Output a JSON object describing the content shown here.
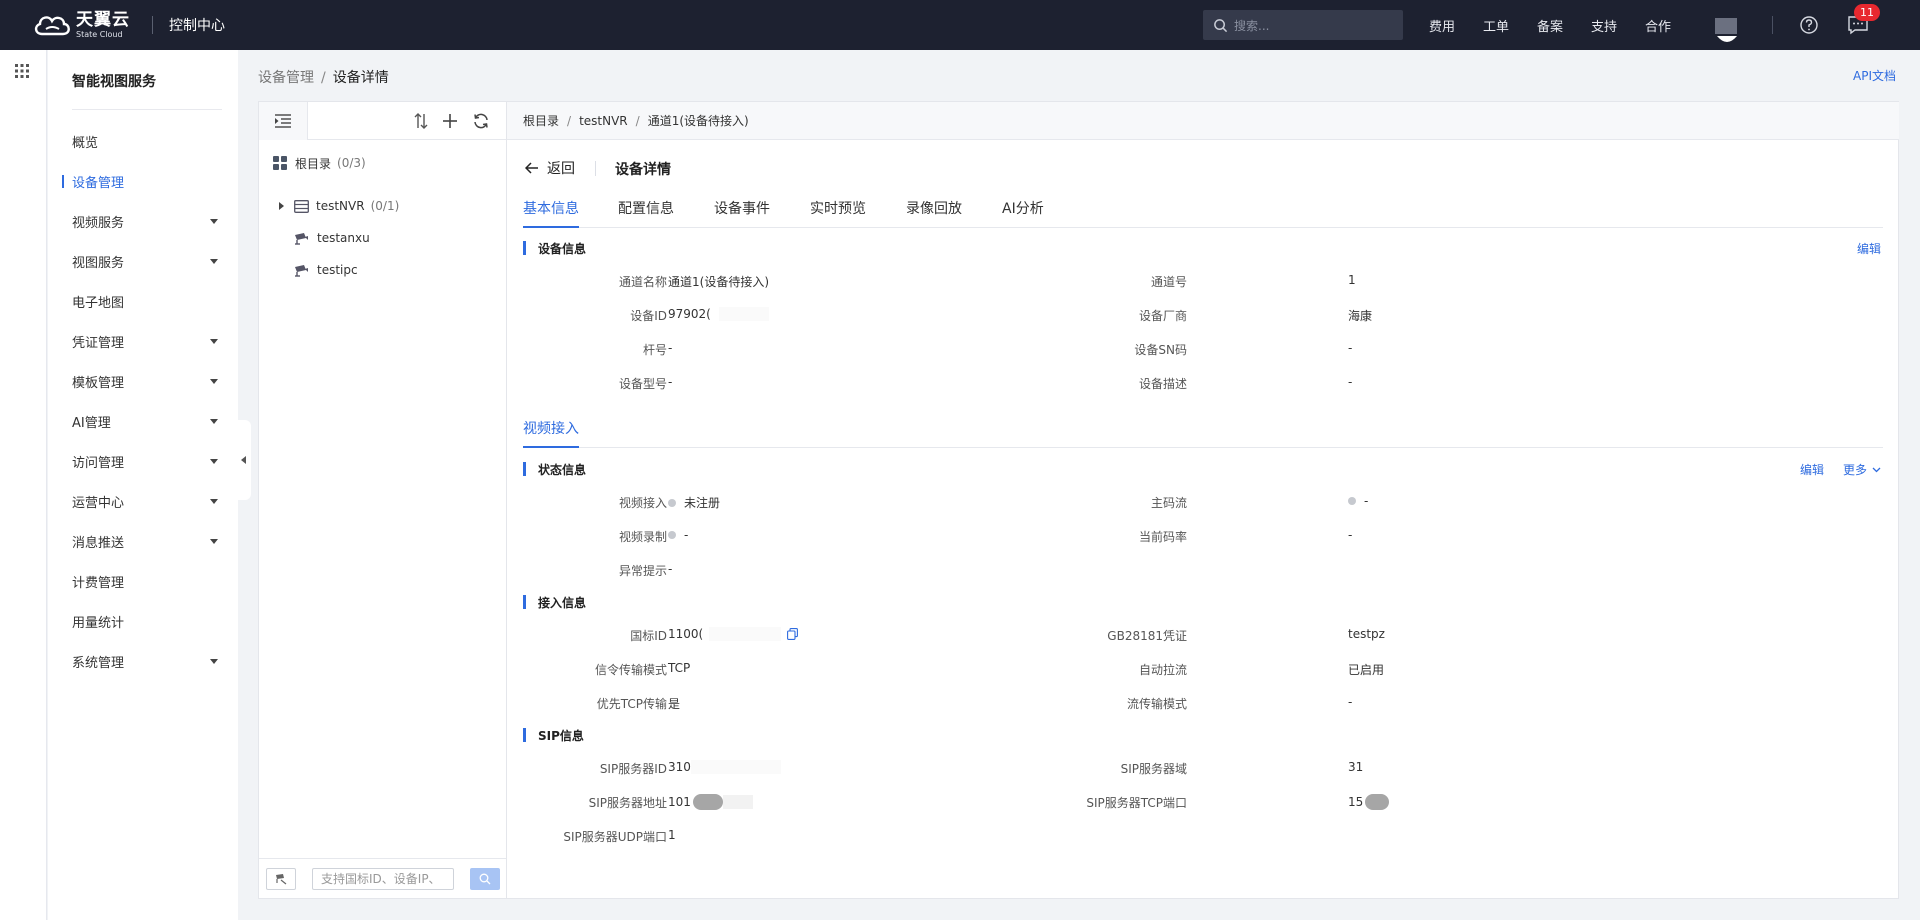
{
  "topbar": {
    "logo_cn": "天翼云",
    "logo_en": "State Cloud",
    "console_title": "控制中心",
    "search_placeholder": "搜索...",
    "nav": [
      "费用",
      "工单",
      "备案",
      "支持",
      "合作"
    ],
    "badge": "11"
  },
  "sidebar": {
    "title": "智能视图服务",
    "items": [
      {
        "label": "概览",
        "caret": false
      },
      {
        "label": "设备管理",
        "caret": false,
        "active": true
      },
      {
        "label": "视频服务",
        "caret": true
      },
      {
        "label": "视图服务",
        "caret": true
      },
      {
        "label": "电子地图",
        "caret": false
      },
      {
        "label": "凭证管理",
        "caret": true
      },
      {
        "label": "模板管理",
        "caret": true
      },
      {
        "label": "AI管理",
        "caret": true
      },
      {
        "label": "访问管理",
        "caret": true
      },
      {
        "label": "运营中心",
        "caret": true
      },
      {
        "label": "消息推送",
        "caret": true
      },
      {
        "label": "计费管理",
        "caret": false
      },
      {
        "label": "用量统计",
        "caret": false
      },
      {
        "label": "系统管理",
        "caret": true
      }
    ]
  },
  "breadcrumb": {
    "parent": "设备管理",
    "current": "设备详情",
    "sep": "/"
  },
  "api_doc": "API文档",
  "tree": {
    "root": {
      "label": "根目录",
      "count": "(0/3)"
    },
    "nodes": [
      {
        "label": "testNVR",
        "count": "(0/1)"
      },
      {
        "label": "testanxu",
        "count": ""
      },
      {
        "label": "testipc",
        "count": ""
      }
    ],
    "search_placeholder": "支持国标ID、设备IP、"
  },
  "main": {
    "crumbs": [
      "根目录",
      "testNVR",
      "通道1(设备待接入)"
    ],
    "back": "返回",
    "title": "设备详情",
    "tabs": [
      "基本信息",
      "配置信息",
      "设备事件",
      "实时预览",
      "录像回放",
      "AI分析"
    ],
    "device_info": {
      "heading": "设备信息",
      "edit": "编辑",
      "rows": [
        {
          "l1": "通道名称",
          "v1": "通道1(设备待接入)",
          "l2": "通道号",
          "v2": "1"
        },
        {
          "l1": "设备ID",
          "v1": "97902(",
          "l2": "设备厂商",
          "v2": "海康"
        },
        {
          "l1": "杆号",
          "v1": "-",
          "l2": "设备SN码",
          "v2": "-"
        },
        {
          "l1": "设备型号",
          "v1": "-",
          "l2": "设备描述",
          "v2": "-"
        }
      ]
    },
    "video_tab": "视频接入",
    "status_info": {
      "heading": "状态信息",
      "edit": "编辑",
      "more": "更多",
      "rows": [
        {
          "l1": "视频接入",
          "v1": "未注册",
          "l2": "主码流",
          "v2": "-"
        },
        {
          "l1": "视频录制",
          "v1": "-",
          "l2": "当前码率",
          "v2": "-"
        },
        {
          "l1": "异常提示",
          "v1": "-",
          "l2": "",
          "v2": ""
        }
      ]
    },
    "access_info": {
      "heading": "接入信息",
      "rows": [
        {
          "l1": "国标ID",
          "v1": "1100(",
          "l2": "GB28181凭证",
          "v2": "testpz"
        },
        {
          "l1": "信令传输模式",
          "v1": "TCP",
          "l2": "自动拉流",
          "v2": "已启用"
        },
        {
          "l1": "优先TCP传输",
          "v1": "是",
          "l2": "流传输模式",
          "v2": "-"
        }
      ]
    },
    "sip_info": {
      "heading": "SIP信息",
      "rows": [
        {
          "l1": "SIP服务器ID",
          "v1": "310",
          "l2": "SIP服务器域",
          "v2": "31"
        },
        {
          "l1": "SIP服务器地址",
          "v1": "101",
          "l2": "SIP服务器TCP端口",
          "v2": "15"
        },
        {
          "l1": "SIP服务器UDP端口",
          "v1": "1",
          "l2": "",
          "v2": ""
        }
      ]
    }
  }
}
